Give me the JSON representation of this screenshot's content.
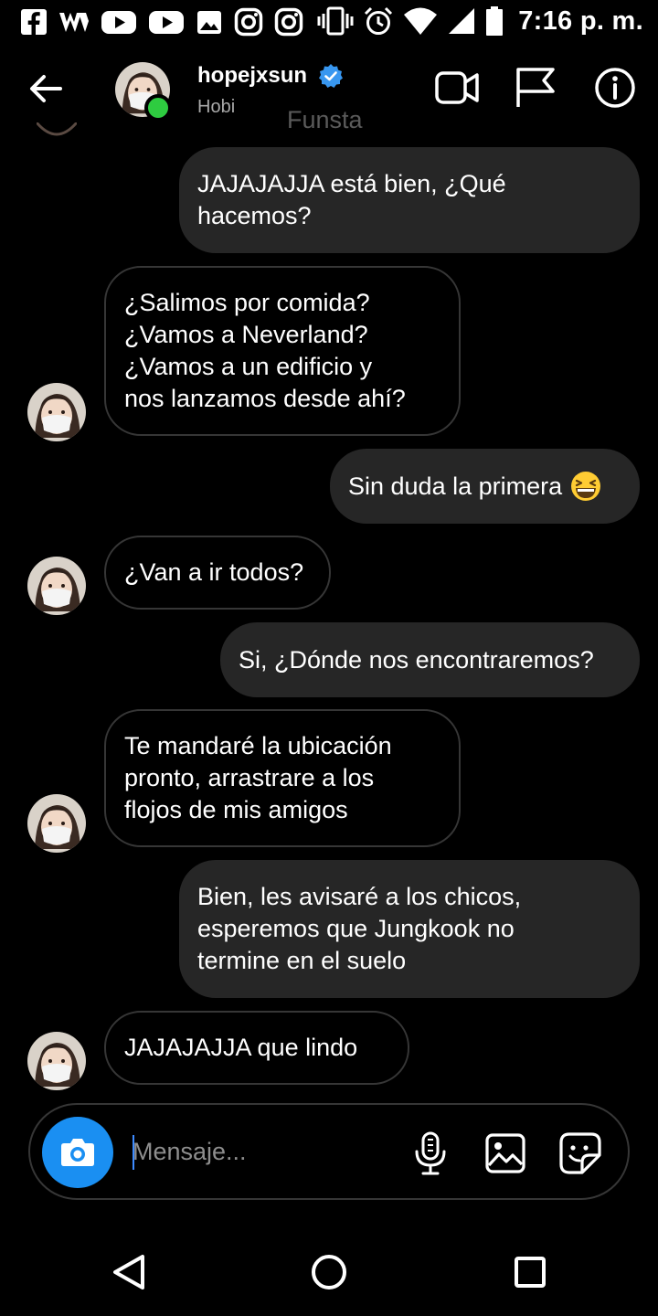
{
  "status_bar": {
    "time": "7:16 p. m.",
    "left_icons": [
      "facebook-icon",
      "webtoon-icon",
      "youtube-icon",
      "youtube-icon",
      "gallery-icon",
      "instagram-icon",
      "instagram-icon"
    ],
    "right_icons": [
      "vibrate-icon",
      "alarm-icon",
      "wifi-icon",
      "signal-icon",
      "battery-icon"
    ]
  },
  "header": {
    "username": "hopejxsun",
    "verified": true,
    "subtitle": "Hobi",
    "watermark": "Funsta",
    "online_color": "#2ecc40",
    "verified_color": "#3897f0"
  },
  "messages": [
    {
      "from": "me",
      "text": "JAJAJAJJA está bien, ¿Qué\nhacemos?"
    },
    {
      "from": "them",
      "text": "¿Salimos por comida?\n¿Vamos a Neverland?\n¿Vamos a un edificio y\nnos lanzamos desde ahí?"
    },
    {
      "from": "me",
      "text": "Sin duda la primera",
      "emoji": "grinning-squinting-face"
    },
    {
      "from": "them",
      "text": "¿Van a ir todos?"
    },
    {
      "from": "me",
      "text": "Si, ¿Dónde nos encontraremos?"
    },
    {
      "from": "them",
      "text": "Te mandaré la ubicación\npronto, arrastrare a los\nflojos de mis amigos"
    },
    {
      "from": "me",
      "text": "Bien, les avisaré a los chicos,\nesperemos que Jungkook no\ntermine en el suelo"
    },
    {
      "from": "them",
      "text": "JAJAJAJJA que lindo"
    }
  ],
  "composer": {
    "placeholder": "Mensaje...",
    "camera_color": "#1a8ff2"
  },
  "colors": {
    "background": "#000000",
    "outgoing_bubble": "#262626",
    "incoming_border": "#363636"
  }
}
